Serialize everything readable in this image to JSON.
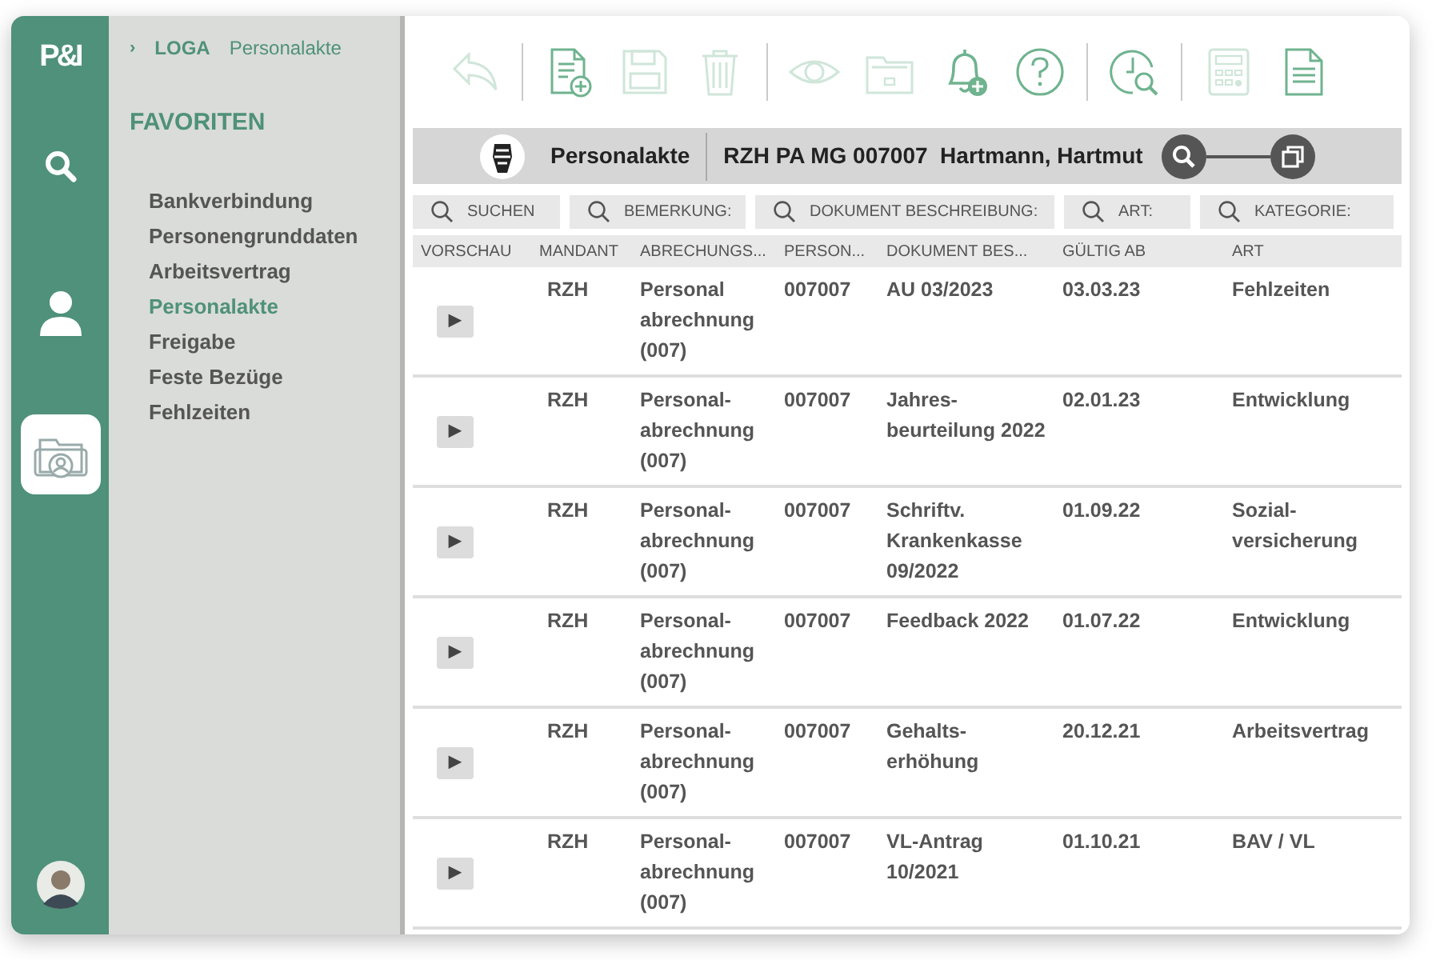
{
  "rail": {
    "logo": "P&I",
    "items": [
      {
        "kind": "search",
        "selected": false
      },
      {
        "kind": "person",
        "selected": false
      },
      {
        "kind": "folder",
        "selected": true
      }
    ]
  },
  "breadcrumb": {
    "chevron": "›",
    "items": [
      "LOGA",
      "Personalakte"
    ]
  },
  "favorites": {
    "title": "FAVORITEN",
    "items": [
      {
        "label": "Bankverbindung",
        "selected": false
      },
      {
        "label": "Personengrunddaten",
        "selected": false
      },
      {
        "label": "Arbeitsvertrag",
        "selected": false
      },
      {
        "label": "Personalakte",
        "selected": true
      },
      {
        "label": "Freigabe",
        "selected": false
      },
      {
        "label": "Feste Bezüge",
        "selected": false
      },
      {
        "label": "Fehlzeiten",
        "selected": false
      }
    ]
  },
  "toolbar": [
    [
      {
        "kind": "undo",
        "disabled": true
      }
    ],
    [
      {
        "kind": "new-document",
        "disabled": false
      },
      {
        "kind": "save",
        "disabled": true
      },
      {
        "kind": "delete",
        "disabled": true
      }
    ],
    [
      {
        "kind": "view",
        "disabled": true
      },
      {
        "kind": "folder",
        "disabled": true
      },
      {
        "kind": "add-alert",
        "disabled": false
      },
      {
        "kind": "help",
        "disabled": false
      }
    ],
    [
      {
        "kind": "clock-search",
        "disabled": false
      }
    ],
    [
      {
        "kind": "calculator",
        "disabled": true
      },
      {
        "kind": "document",
        "disabled": false
      }
    ]
  ],
  "header": {
    "title": "Personalakte",
    "record": "RZH PA MG 007007  Hartmann, Hartmut"
  },
  "filters": [
    "SUCHEN",
    "BEMERKUNG:",
    "DOKUMENT BESCHREIBUNG:",
    "ART:",
    "KATEGORIE:"
  ],
  "table": {
    "columns": [
      "VORSCHAU",
      "MANDANT",
      "ABRECHUNGS...",
      "PERSON...",
      "DOKUMENT BES...",
      "GÜLTIG AB",
      "ART"
    ],
    "rows": [
      [
        "▶",
        "RZH",
        "Personal abrechnung (007)",
        "007007",
        "AU 03/2023",
        "03.03.23",
        "Fehlzeiten"
      ],
      [
        "▶",
        "RZH",
        "Personal-abrechnung (007)",
        "007007",
        "Jahres-beurteilung 2022",
        "02.01.23",
        "Entwicklung"
      ],
      [
        "▶",
        "RZH",
        "Personal-abrechnung (007)",
        "007007",
        "Schriftv. Krankenkasse 09/2022",
        "01.09.22",
        "Sozial-versicherung"
      ],
      [
        "▶",
        "RZH",
        "Personal-abrechnung (007)",
        "007007",
        "Feedback 2022",
        "01.07.22",
        "Entwicklung"
      ],
      [
        "▶",
        "RZH",
        "Personal-abrechnung (007)",
        "007007",
        "Gehalts-erhöhung",
        "20.12.21",
        "Arbeitsvertrag"
      ],
      [
        "▶",
        "RZH",
        "Personal-abrechnung (007)",
        "007007",
        "VL-Antrag 10/2021",
        "01.10.21",
        "BAV / VL"
      ]
    ]
  }
}
